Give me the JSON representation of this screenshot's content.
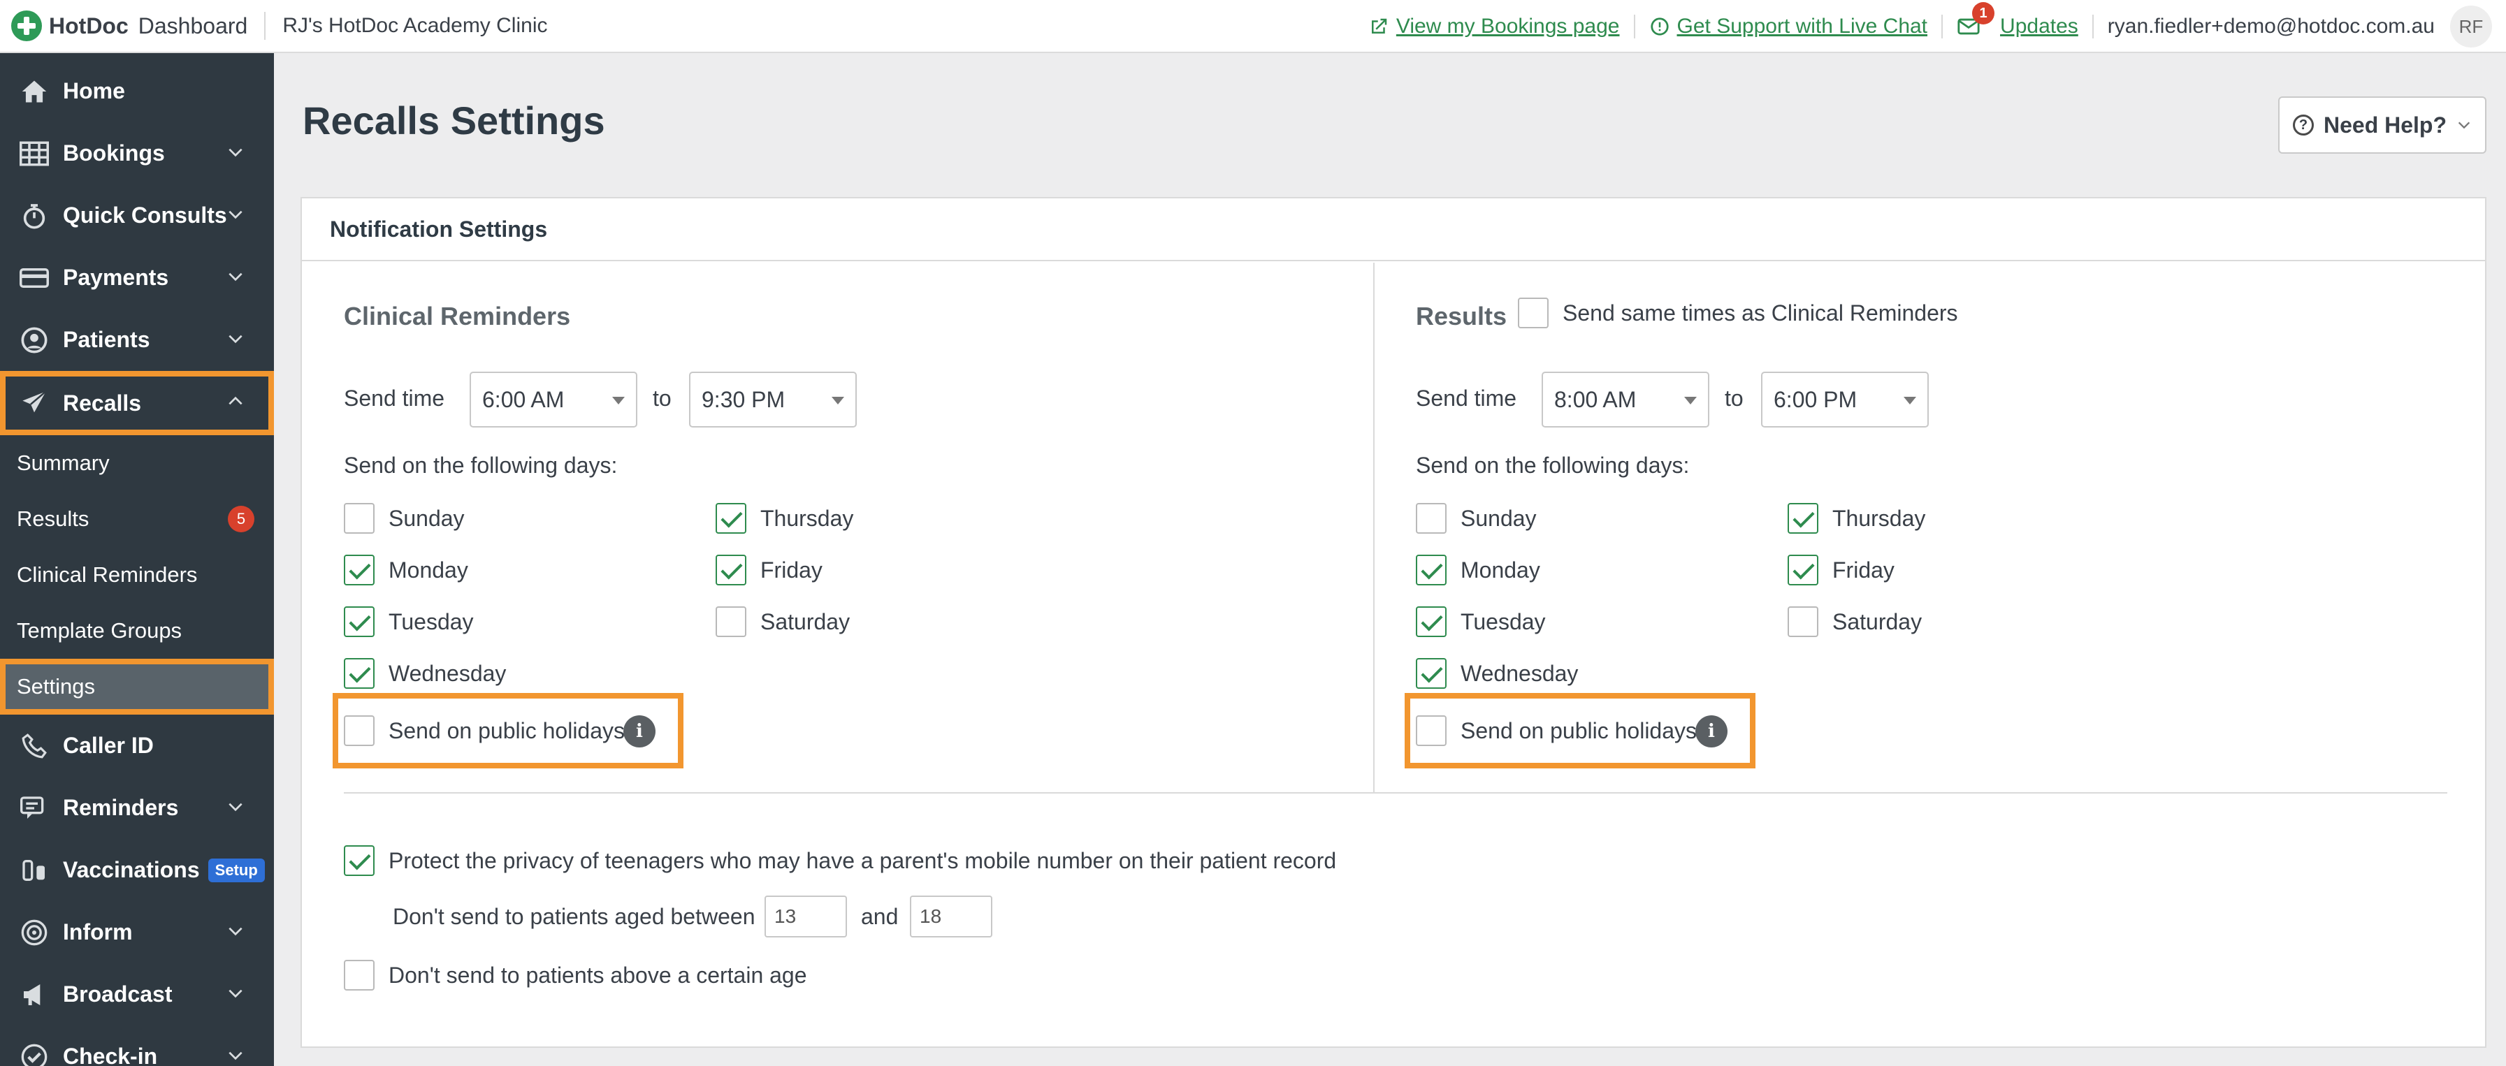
{
  "topbar": {
    "brand": "HotDoc",
    "section": "Dashboard",
    "clinic": "RJ's HotDoc Academy Clinic",
    "links": {
      "bookings": "View my Bookings page",
      "support": "Get Support with Live Chat",
      "updates": "Updates",
      "updates_count": "1"
    },
    "user_email": "ryan.fiedler+demo@hotdoc.com.au",
    "avatar_initials": "RF"
  },
  "sidebar": {
    "items": [
      {
        "label": "Home"
      },
      {
        "label": "Bookings"
      },
      {
        "label": "Quick Consults"
      },
      {
        "label": "Payments"
      },
      {
        "label": "Patients"
      },
      {
        "label": "Recalls"
      },
      {
        "label": "Caller ID"
      },
      {
        "label": "Reminders"
      },
      {
        "label": "Vaccinations",
        "badge": "Setup"
      },
      {
        "label": "Inform"
      },
      {
        "label": "Broadcast"
      },
      {
        "label": "Check-in"
      }
    ],
    "recalls_sub": [
      {
        "label": "Summary"
      },
      {
        "label": "Results",
        "count": "5"
      },
      {
        "label": "Clinical Reminders"
      },
      {
        "label": "Template Groups"
      },
      {
        "label": "Settings"
      }
    ]
  },
  "main": {
    "title": "Recalls Settings",
    "help_button": "Need Help?",
    "card_title": "Notification Settings",
    "clinical": {
      "title": "Clinical Reminders",
      "send_time_label": "Send time",
      "from": "6:00 AM",
      "to_label": "to",
      "to": "9:30 PM",
      "days_label": "Send on the following days:",
      "days": {
        "sunday": "Sunday",
        "monday": "Monday",
        "tuesday": "Tuesday",
        "wednesday": "Wednesday",
        "thursday": "Thursday",
        "friday": "Friday",
        "saturday": "Saturday"
      },
      "holidays": "Send on public holidays"
    },
    "results": {
      "title": "Results",
      "same_times": "Send same times as Clinical Reminders",
      "send_time_label": "Send time",
      "from": "8:00 AM",
      "to_label": "to",
      "to": "6:00 PM",
      "days_label": "Send on the following days:",
      "days": {
        "sunday": "Sunday",
        "monday": "Monday",
        "tuesday": "Tuesday",
        "wednesday": "Wednesday",
        "thursday": "Thursday",
        "friday": "Friday",
        "saturday": "Saturday"
      },
      "holidays": "Send on public holidays"
    },
    "privacy": {
      "protect_label": "Protect the privacy of teenagers who may have a parent's mobile number on their patient record",
      "between_label": "Don't send to patients aged between",
      "min_age": "13",
      "and_label": "and",
      "max_age": "18",
      "above_label": "Don't send to patients above a certain age"
    }
  },
  "colors": {
    "accent_green": "#2e8b4e",
    "highlight_orange": "#f2962f",
    "sidebar_bg": "#2f3941",
    "badge_red": "#d8412c"
  }
}
